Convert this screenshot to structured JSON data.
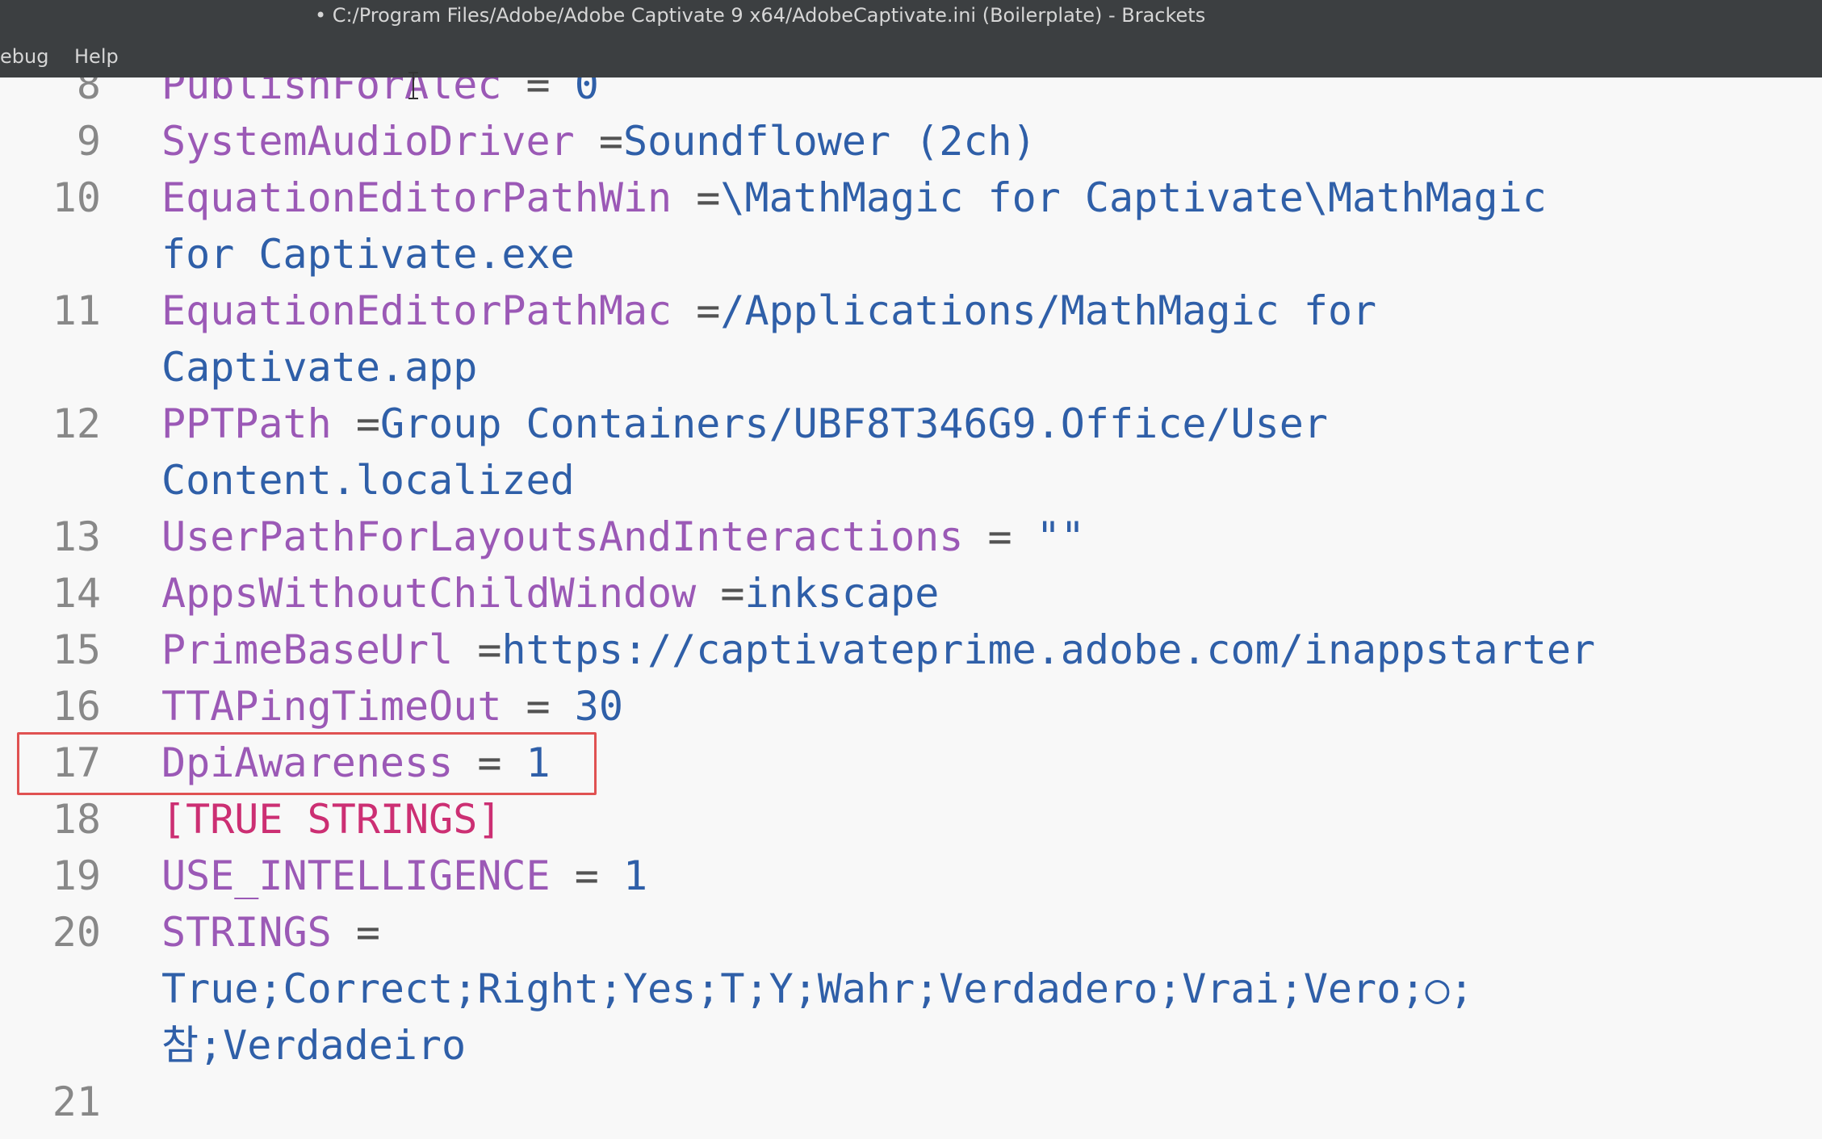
{
  "window": {
    "title": "• C:/Program Files/Adobe/Adobe Captivate 9 x64/AdobeCaptivate.ini (Boilerplate) - Brackets"
  },
  "menu": {
    "items": [
      "ebug",
      "Help"
    ]
  },
  "editor": {
    "lines": [
      {
        "num": "8",
        "key": "PublishForAlec",
        "sep": " = ",
        "val": "0"
      },
      {
        "num": "9",
        "key": "SystemAudioDriver",
        "sep": " =",
        "val": "Soundflower (2ch)"
      },
      {
        "num": "10",
        "key": "EquationEditorPathWin",
        "sep": " =",
        "val": "\\MathMagic for Captivate\\MathMagic"
      },
      {
        "num": "",
        "key": "",
        "sep": "",
        "val": "for Captivate.exe"
      },
      {
        "num": "11",
        "key": "EquationEditorPathMac",
        "sep": " =",
        "val": "/Applications/MathMagic for"
      },
      {
        "num": "",
        "key": "",
        "sep": "",
        "val": "Captivate.app"
      },
      {
        "num": "12",
        "key": "PPTPath",
        "sep": " =",
        "val": "Group Containers/UBF8T346G9.Office/User"
      },
      {
        "num": "",
        "key": "",
        "sep": "",
        "val": "Content.localized"
      },
      {
        "num": "13",
        "key": "UserPathForLayoutsAndInteractions",
        "sep": " = ",
        "val": "\"\""
      },
      {
        "num": "14",
        "key": "AppsWithoutChildWindow",
        "sep": " =",
        "val": "inkscape"
      },
      {
        "num": "15",
        "key": "PrimeBaseUrl",
        "sep": " =",
        "val": "https://captivateprime.adobe.com/inappstarter"
      },
      {
        "num": "16",
        "key": "TTAPingTimeOut",
        "sep": " = ",
        "val": "30"
      },
      {
        "num": "17",
        "key": "DpiAwareness",
        "sep": " = ",
        "val": "1"
      },
      {
        "num": "18",
        "section": "[TRUE STRINGS]"
      },
      {
        "num": "19",
        "key": "USE_INTELLIGENCE",
        "sep": " = ",
        "val": "1"
      },
      {
        "num": "20",
        "key": "STRINGS",
        "sep": " =",
        "val": ""
      },
      {
        "num": "",
        "key": "",
        "sep": "",
        "val": "True;Correct;Right;Yes;T;Y;Wahr;Verdadero;Vrai;Vero;○;"
      },
      {
        "num": "",
        "key": "",
        "sep": "",
        "val": "참;Verdadeiro"
      },
      {
        "num": "21",
        "key": "",
        "sep": "",
        "val": ""
      }
    ]
  },
  "colors": {
    "key": "#9b59b6",
    "value": "#2f5fa8",
    "section": "#cc2f73",
    "highlight": "#e05252"
  }
}
